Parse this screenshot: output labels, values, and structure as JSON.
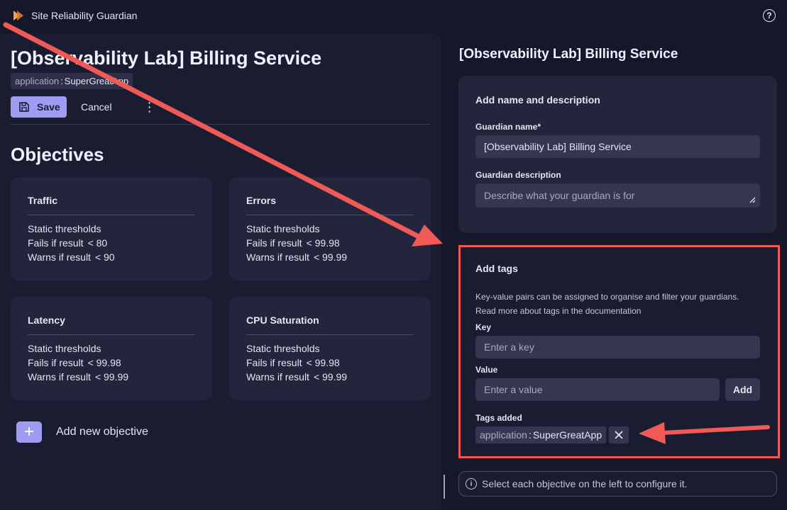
{
  "app": {
    "title": "Site Reliability Guardian"
  },
  "left": {
    "title": "[Observability Lab] Billing Service",
    "tag": {
      "key": "application",
      "sep": ":",
      "value": "SuperGreatApp"
    },
    "save_label": "Save",
    "cancel_label": "Cancel",
    "more_label": "⋮",
    "objectives_title": "Objectives",
    "objectives": [
      {
        "name": "Traffic",
        "type": "Static thresholds",
        "fails_label": "Fails if result",
        "fails_value": "< 80",
        "warns_label": "Warns if result",
        "warns_value": "< 90"
      },
      {
        "name": "Errors",
        "type": "Static thresholds",
        "fails_label": "Fails if result",
        "fails_value": "< 99.98",
        "warns_label": "Warns if result",
        "warns_value": "< 99.99"
      },
      {
        "name": "Latency",
        "type": "Static thresholds",
        "fails_label": "Fails if result",
        "fails_value": "< 99.98",
        "warns_label": "Warns if result",
        "warns_value": "< 99.99"
      },
      {
        "name": "CPU Saturation",
        "type": "Static thresholds",
        "fails_label": "Fails if result",
        "fails_value": "< 99.98",
        "warns_label": "Warns if result",
        "warns_value": "< 99.99"
      }
    ],
    "add_objective_label": "Add new objective"
  },
  "right": {
    "title": "[Observability Lab] Billing Service",
    "name_section": {
      "title": "Add name and description",
      "name_label": "Guardian name*",
      "name_value": "[Observability Lab] Billing Service",
      "desc_label": "Guardian description",
      "desc_placeholder": "Describe what your guardian is for"
    },
    "tags_section": {
      "title": "Add tags",
      "help_line1": "Key-value pairs can be assigned to organise and filter your guardians.",
      "help_line2": "Read more about tags in the documentation",
      "key_label": "Key",
      "key_placeholder": "Enter a key",
      "value_label": "Value",
      "value_placeholder": "Enter a value",
      "add_label": "Add",
      "added_label": "Tags added",
      "added_tag": {
        "key": "application",
        "sep": ":",
        "value": "SuperGreatApp"
      }
    },
    "info_text": "Select each objective on the left to configure it."
  },
  "colors": {
    "accent": "#a09cf2",
    "annotation": "#ef5a56",
    "background": "#15182b",
    "panel": "#1a1d31",
    "card": "#22253b"
  }
}
